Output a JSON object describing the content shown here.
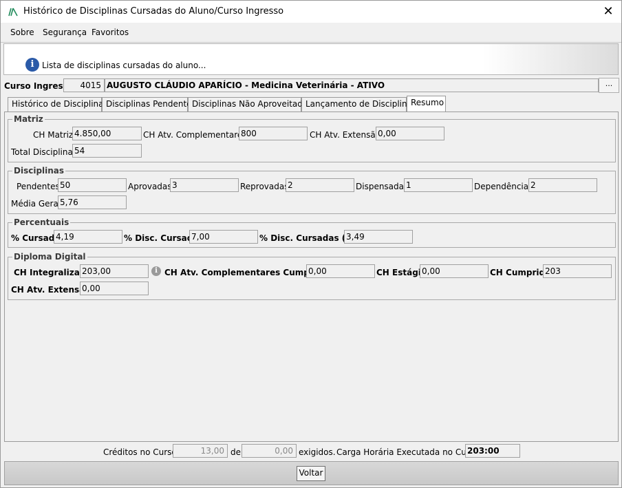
{
  "window": {
    "title": "Histórico de Disciplinas Cursadas do Aluno/Curso Ingresso",
    "close_glyph": "✕"
  },
  "menu": [
    "Sobre",
    "Segurança",
    "Favoritos"
  ],
  "banner": {
    "icon": "info-icon",
    "text": "Lista de disciplinas cursadas do aluno..."
  },
  "curso": {
    "label": "Curso Ingresso:",
    "code": "4015",
    "description": "AUGUSTO CLÁUDIO APARÍCIO - Medicina Veterinária - ATIVO",
    "lookup_button": "..."
  },
  "tabs": [
    {
      "label": "Histórico de Disciplinas",
      "active": false
    },
    {
      "label": "Disciplinas Pendentes",
      "active": false
    },
    {
      "label": "Disciplinas Não Aproveitadas",
      "active": false
    },
    {
      "label": "Lançamento de Disciplinas",
      "active": false
    },
    {
      "label": "Resumo",
      "active": true
    }
  ],
  "matriz": {
    "title": "Matriz",
    "ch_matriz_label": "CH Matriz:",
    "ch_matriz": "4.850,00",
    "ch_atv_complementares_label": "CH Atv. Complementares:",
    "ch_atv_complementares": "800",
    "ch_atv_extensao_label": "CH Atv. Extensão:",
    "ch_atv_extensao": "0,00",
    "total_disciplinas_label": "Total Disciplinas:",
    "total_disciplinas": "54"
  },
  "disciplinas": {
    "title": "Disciplinas",
    "pendentes_label": "Pendentes:",
    "pendentes": "50",
    "aprovadas_label": "Aprovadas:",
    "aprovadas": "3",
    "reprovadas_label": "Reprovadas:",
    "reprovadas": "2",
    "dispensadas_label": "Dispensadas:",
    "dispensadas": "1",
    "dependencias_label": "Dependências:",
    "dependencias": "2",
    "media_geral_label": "Média Geral:",
    "media_geral": "5,76"
  },
  "percentuais": {
    "title": "Percentuais",
    "cursado_label": "% Cursado:",
    "cursado": "4,19",
    "disc_cursadas_label": "% Disc. Cursadas:",
    "disc_cursadas": "7,00",
    "disc_cursadas_hr_label": "% Disc. Cursadas (HR):",
    "disc_cursadas_hr": "3,49"
  },
  "diploma": {
    "title": "Diploma Digital",
    "ch_integralizada_label": "CH Integralizada:",
    "ch_integralizada": "203,00",
    "ch_atv_complementares_cumpridas_label": "CH Atv. Complementares Cumpridas:",
    "ch_atv_complementares_cumpridas": "0,00",
    "ch_estagio_label": "CH Estágio:",
    "ch_estagio": "0,00",
    "ch_cumprida_label": "CH Cumprida:",
    "ch_cumprida": "203",
    "ch_atv_extensao_label": "CH Atv. Extensão:",
    "ch_atv_extensao": "0,00"
  },
  "footer": {
    "creditos_label": "Créditos no Curso:",
    "creditos": "13,00",
    "de_label": "de",
    "exigidos": "0,00",
    "exigidos_label": "exigidos.",
    "carga_label": "Carga Horária Executada no Curso:",
    "carga": "203:00"
  },
  "buttons": {
    "voltar": "Voltar"
  }
}
